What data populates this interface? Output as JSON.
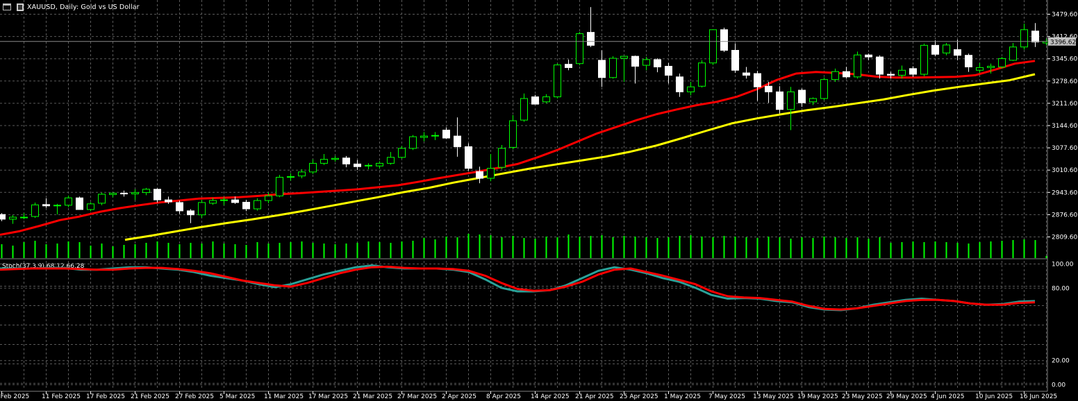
{
  "header": {
    "symbol_title": "XAUUSD, Daily:  Gold vs US Dollar",
    "window_icon": "window-icon",
    "chart_icon": "bar-chart-icon"
  },
  "price_axis": {
    "labels": [
      "3479.60",
      "3412.60",
      "3345.60",
      "3278.60",
      "3211.60",
      "3144.60",
      "3077.60",
      "3010.60",
      "2943.60",
      "2876.60",
      "2809.60"
    ],
    "current_price": "3396.62"
  },
  "indicator": {
    "label": "Stoch(37,3,9) 68.12 66.28",
    "levels": [
      "100.00",
      "80.00",
      "20.00",
      "0.00"
    ]
  },
  "date_axis": {
    "labels": [
      "5 Feb 2025",
      "11 Feb 2025",
      "17 Feb 2025",
      "21 Feb 2025",
      "27 Feb 2025",
      "5 Mar 2025",
      "11 Mar 2025",
      "17 Mar 2025",
      "21 Mar 2025",
      "27 Mar 2025",
      "2 Apr 2025",
      "8 Apr 2025",
      "14 Apr 2025",
      "21 Apr 2025",
      "25 Apr 2025",
      "1 May 2025",
      "7 May 2025",
      "13 May 2025",
      "19 May 2025",
      "23 May 2025",
      "29 May 2025",
      "4 Jun 2025",
      "10 Jun 2025",
      "16 Jun 2025"
    ]
  },
  "colors": {
    "background": "#000000",
    "grid": "#5a5a5a",
    "bull_candle": "#00ff00",
    "bear_candle": "#ffffff",
    "volume": "#00ff00",
    "ma_fast": "#ff0000",
    "ma_slow": "#ffff00",
    "stoch_main": "#2aa198",
    "stoch_signal": "#ff0000",
    "axis_text": "#ffffff",
    "price_box": "#c0c0c0"
  },
  "chart_data": {
    "type": "candlestick",
    "symbol": "XAUUSD",
    "timeframe": "Daily",
    "ylim": [
      2810,
      3500
    ],
    "candles": [
      [
        2876.0,
        2880.0,
        2856.0,
        2862.0
      ],
      [
        2862.0,
        2874.0,
        2848.0,
        2868.0
      ],
      [
        2866.0,
        2880.0,
        2862.0,
        2868.0
      ],
      [
        2870.0,
        2912.0,
        2866.0,
        2905.0
      ],
      [
        2906.0,
        2925.0,
        2896.0,
        2902.0
      ],
      [
        2902.0,
        2908.0,
        2876.0,
        2904.0
      ],
      [
        2904.0,
        2933.0,
        2898.0,
        2926.0
      ],
      [
        2926.0,
        2930.0,
        2895.0,
        2891.0
      ],
      [
        2891.0,
        2913.0,
        2886.0,
        2908.0
      ],
      [
        2910.0,
        2942.0,
        2904.0,
        2937.0
      ],
      [
        2936.0,
        2942.0,
        2928.0,
        2940.0
      ],
      [
        2940.0,
        2948.0,
        2930.0,
        2938.0
      ],
      [
        2938.0,
        2952.0,
        2920.0,
        2942.0
      ],
      [
        2942.0,
        2956.0,
        2934.0,
        2952.0
      ],
      [
        2952.0,
        2955.0,
        2912.0,
        2920.0
      ],
      [
        2920.0,
        2930.0,
        2908.0,
        2914.0
      ],
      [
        2912.0,
        2918.0,
        2878.0,
        2887.0
      ],
      [
        2887.0,
        2892.0,
        2850.0,
        2875.0
      ],
      [
        2875.0,
        2920.0,
        2866.0,
        2912.0
      ],
      [
        2910.0,
        2926.0,
        2905.0,
        2918.0
      ],
      [
        2918.0,
        2928.0,
        2904.0,
        2920.0
      ],
      [
        2920.0,
        2930.0,
        2908.0,
        2912.0
      ],
      [
        2913.0,
        2920.0,
        2886.0,
        2893.0
      ],
      [
        2893.0,
        2925.0,
        2888.0,
        2918.0
      ],
      [
        2918.0,
        2942.0,
        2910.0,
        2932.0
      ],
      [
        2932.0,
        2995.0,
        2928.0,
        2988.0
      ],
      [
        2988.0,
        3000.0,
        2978.0,
        2990.0
      ],
      [
        2992.0,
        3012.0,
        2985.0,
        3004.0
      ],
      [
        3004.0,
        3042.0,
        2998.0,
        3030.0
      ],
      [
        3030.0,
        3058.0,
        3025.0,
        3042.0
      ],
      [
        3042.0,
        3052.0,
        3035.0,
        3045.0
      ],
      [
        3046.0,
        3052.0,
        3018.0,
        3028.0
      ],
      [
        3028.0,
        3040.0,
        3010.0,
        3020.0
      ],
      [
        3022.0,
        3030.0,
        3012.0,
        3024.0
      ],
      [
        3022.0,
        3036.0,
        3014.0,
        3030.0
      ],
      [
        3030.0,
        3064.0,
        3026.0,
        3048.0
      ],
      [
        3048.0,
        3082.0,
        3044.0,
        3075.0
      ],
      [
        3075.0,
        3115.0,
        3070.0,
        3110.0
      ],
      [
        3108.0,
        3124.0,
        3096.0,
        3112.0
      ],
      [
        3112.0,
        3124.0,
        3100.0,
        3114.0
      ],
      [
        3130.0,
        3138.0,
        3104.0,
        3106.0
      ],
      [
        3112.0,
        3168.0,
        3050.0,
        3080.0
      ],
      [
        3080.0,
        3090.0,
        3008.0,
        3015.0
      ],
      [
        3005.0,
        3020.0,
        2970.0,
        2985.0
      ],
      [
        2985.0,
        3058.0,
        2976.0,
        3015.0
      ],
      [
        3018.0,
        3085.0,
        3012.0,
        3075.0
      ],
      [
        3078.0,
        3175.0,
        3072.0,
        3158.0
      ],
      [
        3160.0,
        3240.0,
        3155.0,
        3225.0
      ],
      [
        3230.0,
        3236.0,
        3218.0,
        3208.0
      ],
      [
        3215.0,
        3238.0,
        3210.0,
        3230.0
      ],
      [
        3230.0,
        3330.0,
        3225.0,
        3326.0
      ],
      [
        3328.0,
        3342.0,
        3310.0,
        3318.0
      ],
      [
        3330.0,
        3425.0,
        3325.0,
        3420.0
      ],
      [
        3424.0,
        3500.0,
        3380.0,
        3385.0
      ],
      [
        3340.0,
        3370.0,
        3260.0,
        3288.0
      ],
      [
        3288.0,
        3352.0,
        3285.0,
        3346.0
      ],
      [
        3346.0,
        3352.0,
        3275.0,
        3352.0
      ],
      [
        3352.0,
        3354.0,
        3270.0,
        3322.0
      ],
      [
        3325.0,
        3350.0,
        3310.0,
        3342.0
      ],
      [
        3342.0,
        3346.0,
        3304.0,
        3320.0
      ],
      [
        3322.0,
        3332.0,
        3270.0,
        3295.0
      ],
      [
        3290.0,
        3300.0,
        3230.0,
        3245.0
      ],
      [
        3245.0,
        3275.0,
        3235.0,
        3260.0
      ],
      [
        3262.0,
        3340.0,
        3258.0,
        3332.0
      ],
      [
        3332.0,
        3432.0,
        3326.0,
        3432.0
      ],
      [
        3432.0,
        3438.0,
        3365.0,
        3370.0
      ],
      [
        3370.0,
        3390.0,
        3302.0,
        3310.0
      ],
      [
        3302.0,
        3320.0,
        3285.0,
        3295.0
      ],
      [
        3300.0,
        3308.0,
        3218.0,
        3260.0
      ],
      [
        3262.0,
        3275.0,
        3212.0,
        3245.0
      ],
      [
        3245.0,
        3262.0,
        3180.0,
        3192.0
      ],
      [
        3192.0,
        3260.0,
        3130.0,
        3245.0
      ],
      [
        3250.0,
        3255.0,
        3200.0,
        3212.0
      ],
      [
        3215.0,
        3228.0,
        3205.0,
        3225.0
      ],
      [
        3225.0,
        3288.0,
        3220.0,
        3282.0
      ],
      [
        3282.0,
        3315.0,
        3275.0,
        3306.0
      ],
      [
        3306.0,
        3320.0,
        3285.0,
        3290.0
      ],
      [
        3290.0,
        3366.0,
        3285.0,
        3356.0
      ],
      [
        3356.0,
        3360.0,
        3340.0,
        3350.0
      ],
      [
        3350.0,
        3355.0,
        3285.0,
        3298.0
      ],
      [
        3298.0,
        3305.0,
        3285.0,
        3295.0
      ],
      [
        3295.0,
        3324.0,
        3285.0,
        3310.0
      ],
      [
        3315.0,
        3322.0,
        3290.0,
        3298.0
      ],
      [
        3298.0,
        3390.0,
        3292.0,
        3385.0
      ],
      [
        3385.0,
        3400.0,
        3352.0,
        3358.0
      ],
      [
        3362.0,
        3392.0,
        3355.0,
        3386.0
      ],
      [
        3372.0,
        3402.0,
        3340.0,
        3355.0
      ],
      [
        3355.0,
        3360.0,
        3305.0,
        3320.0
      ],
      [
        3310.0,
        3332.0,
        3302.0,
        3318.0
      ],
      [
        3318.0,
        3330.0,
        3300.0,
        3322.0
      ],
      [
        3320.0,
        3350.0,
        3315.0,
        3345.0
      ],
      [
        3340.0,
        3392.0,
        3338.0,
        3380.0
      ],
      [
        3380.0,
        3450.0,
        3372.0,
        3432.0
      ],
      [
        3428.0,
        3452.0,
        3380.0,
        3395.0
      ],
      [
        3392.0,
        3405.0,
        3385.0,
        3396.62
      ]
    ],
    "ma_fast": [
      2815.0,
      2826.0,
      2842.0,
      2859.0,
      2870.0,
      2884.0,
      2895.0,
      2904.0,
      2912.0,
      2918.0,
      2924.0,
      2926.0,
      2928.0,
      2932.0,
      2937.0,
      2940.0,
      2944.0,
      2948.0,
      2952.0,
      2958.0,
      2964.0,
      2974.0,
      2985.0,
      2995.0,
      3005.0,
      3016.0,
      3028.0,
      3048.0,
      3070.0,
      3095.0,
      3120.0,
      3140.0,
      3160.0,
      3178.0,
      3192.0,
      3205.0,
      3215.0,
      3230.0,
      3252.0,
      3280.0,
      3300.0,
      3305.0,
      3302.0,
      3298.0,
      3291.0,
      3288.0,
      3288.0,
      3289.0,
      3290.0,
      3295.0,
      3312.0,
      3330.0,
      3338.0
    ],
    "ma_slow": [
      2800.0,
      2812.0,
      2825.0,
      2838.0,
      2850.0,
      2861.0,
      2873.0,
      2886.0,
      2900.0,
      2914.0,
      2928.0,
      2943.0,
      2956.0,
      2972.0,
      2986.0,
      3000.0,
      3014.0,
      3026.0,
      3038.0,
      3050.0,
      3065.0,
      3083.0,
      3105.0,
      3128.0,
      3150.0,
      3165.0,
      3178.0,
      3190.0,
      3200.0,
      3211.0,
      3222.0,
      3236.0,
      3249.0,
      3260.0,
      3270.0,
      3280.0,
      3298.0
    ],
    "volume": [
      20,
      18,
      23,
      25,
      20,
      21,
      24,
      23,
      18,
      21,
      17,
      19,
      20,
      22,
      24,
      22,
      20,
      22,
      21,
      24,
      21,
      20,
      19,
      23,
      21,
      22,
      23,
      24,
      22,
      21,
      20,
      21,
      22,
      24,
      23,
      22,
      24,
      25,
      29,
      27,
      31,
      30,
      35,
      34,
      33,
      30,
      32,
      29,
      28,
      31,
      30,
      34,
      31,
      32,
      33,
      30,
      32,
      31,
      30,
      29,
      30,
      32,
      33,
      31,
      30,
      32,
      31,
      30,
      29,
      31,
      30,
      28,
      30,
      29,
      31,
      30,
      29,
      30,
      28,
      30,
      22,
      23,
      24,
      23,
      24,
      23,
      22,
      21,
      23,
      24,
      25,
      26,
      27,
      26,
      3
    ],
    "stochastic": {
      "ylim": [
        0,
        100
      ],
      "main": [
        96.0,
        96.0,
        96.0,
        96.5,
        96.5,
        95.0,
        95.0,
        96.0,
        97.0,
        97.0,
        96.0,
        95.0,
        93.0,
        90.0,
        88.0,
        86.0,
        83.0,
        80.5,
        83.0,
        87.0,
        91.0,
        94.0,
        97.0,
        98.5,
        97.0,
        96.0,
        96.0,
        96.0,
        95.0,
        93.0,
        87.0,
        80.0,
        77.0,
        77.0,
        78.0,
        82.0,
        88.0,
        94.0,
        97.0,
        95.0,
        92.0,
        88.0,
        85.0,
        80.0,
        74.0,
        71.0,
        71.5,
        71.0,
        69.0,
        68.0,
        64.0,
        62.0,
        61.5,
        63.0,
        66.0,
        68.0,
        70.0,
        71.0,
        70.0,
        69.0,
        67.0,
        66.0,
        66.5,
        68.5,
        69.0
      ],
      "signal": [
        95.0,
        95.5,
        96.0,
        96.0,
        96.0,
        95.5,
        95.0,
        95.0,
        96.0,
        96.5,
        96.5,
        95.5,
        94.0,
        92.0,
        89.0,
        86.0,
        84.0,
        82.0,
        81.0,
        84.0,
        88.0,
        92.0,
        95.0,
        97.0,
        97.5,
        96.5,
        96.0,
        96.0,
        95.5,
        94.0,
        90.0,
        84.0,
        79.0,
        77.5,
        78.0,
        81.0,
        85.0,
        91.0,
        95.0,
        96.0,
        93.0,
        90.0,
        86.5,
        83.0,
        77.0,
        73.0,
        72.0,
        71.5,
        70.0,
        68.5,
        65.0,
        62.5,
        62.0,
        63.0,
        65.0,
        67.0,
        69.0,
        70.0,
        70.0,
        69.0,
        67.0,
        66.0,
        66.0,
        67.5,
        68.0
      ],
      "levels": [
        20,
        80
      ],
      "current_main": 68.12,
      "current_signal": 66.28
    }
  }
}
